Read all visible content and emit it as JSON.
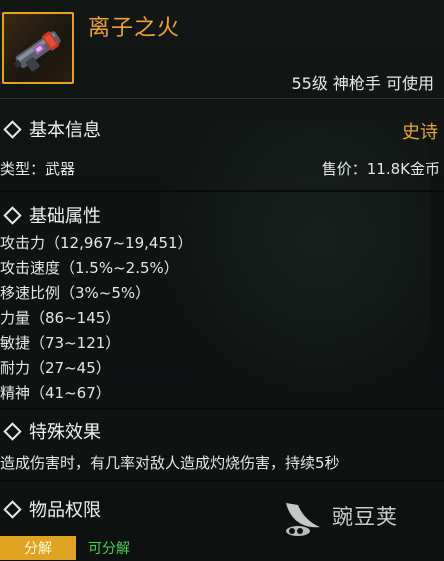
{
  "item": {
    "name": "离子之火",
    "requirement": "55级 神枪手 可使用",
    "icon": "weapon-item-icon",
    "rarity_color": "#e9a62a"
  },
  "basic_info": {
    "title": "基本信息",
    "rarity": "史诗",
    "type": "类型：武器",
    "price": "售价：11.8K金币"
  },
  "attributes": {
    "title": "基础属性",
    "items": [
      "攻击力（12,967~19,451）",
      "攻击速度（1.5%~2.5%）",
      "移速比例（3%~5%）",
      "力量（86~145）",
      "敏捷（73~121）",
      "耐力（27~45）",
      "精神（41~67）"
    ]
  },
  "special": {
    "title": "特殊效果",
    "description": "造成伤害时，有几率对敌人造成灼烧伤害，持续5秒"
  },
  "permissions": {
    "title": "物品权限",
    "decompose_label": "分解",
    "decompose_status": "可分解"
  },
  "watermark": {
    "text": "豌豆荚"
  }
}
